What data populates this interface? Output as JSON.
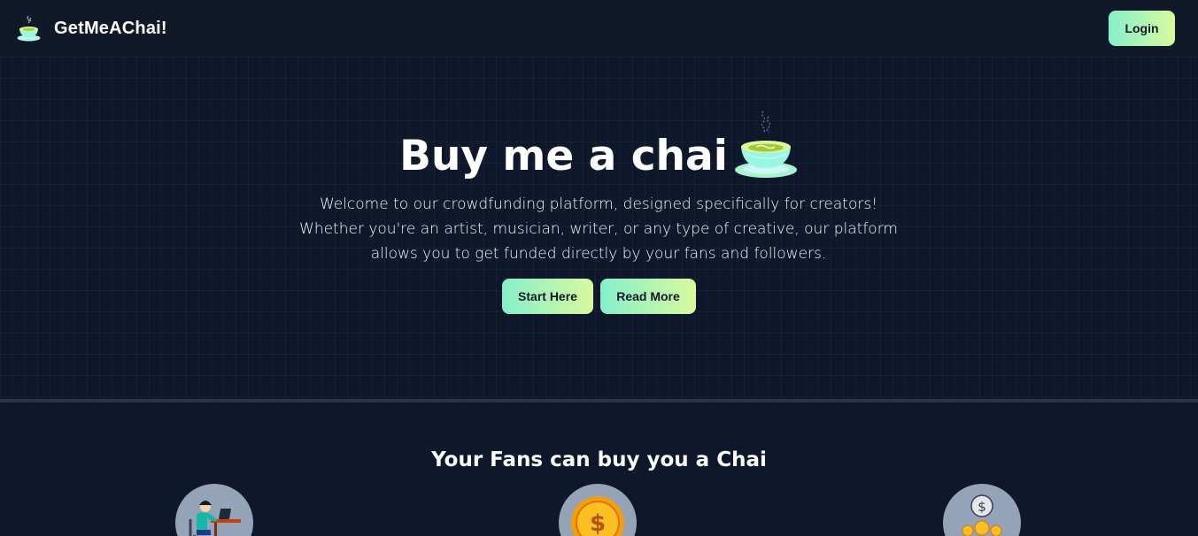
{
  "nav": {
    "brand_name": "GetMeAChai!",
    "logo_icon": "tea-cup-icon",
    "login_label": "Login"
  },
  "hero": {
    "title": "Buy me a chai",
    "title_icon": "steaming-tea-cup-icon",
    "description": "Welcome to our crowdfunding platform, designed specifically for creators! Whether you're an artist, musician, writer, or any type of creative, our platform allows you to get funded directly by your fans and followers.",
    "buttons": {
      "start_label": "Start Here",
      "read_more_label": "Read More"
    }
  },
  "fans_section": {
    "title": "Your Fans can buy you a Chai",
    "features": [
      {
        "icon": "person-at-laptop-icon"
      },
      {
        "icon": "dollar-coin-icon"
      },
      {
        "icon": "coins-stack-icon"
      }
    ]
  },
  "colors": {
    "background": "#0f172a",
    "nav_background": "#111827",
    "button_gradient_start": "#86efcb",
    "button_gradient_end": "#d9f99d",
    "feature_circle": "#94a3b8"
  }
}
